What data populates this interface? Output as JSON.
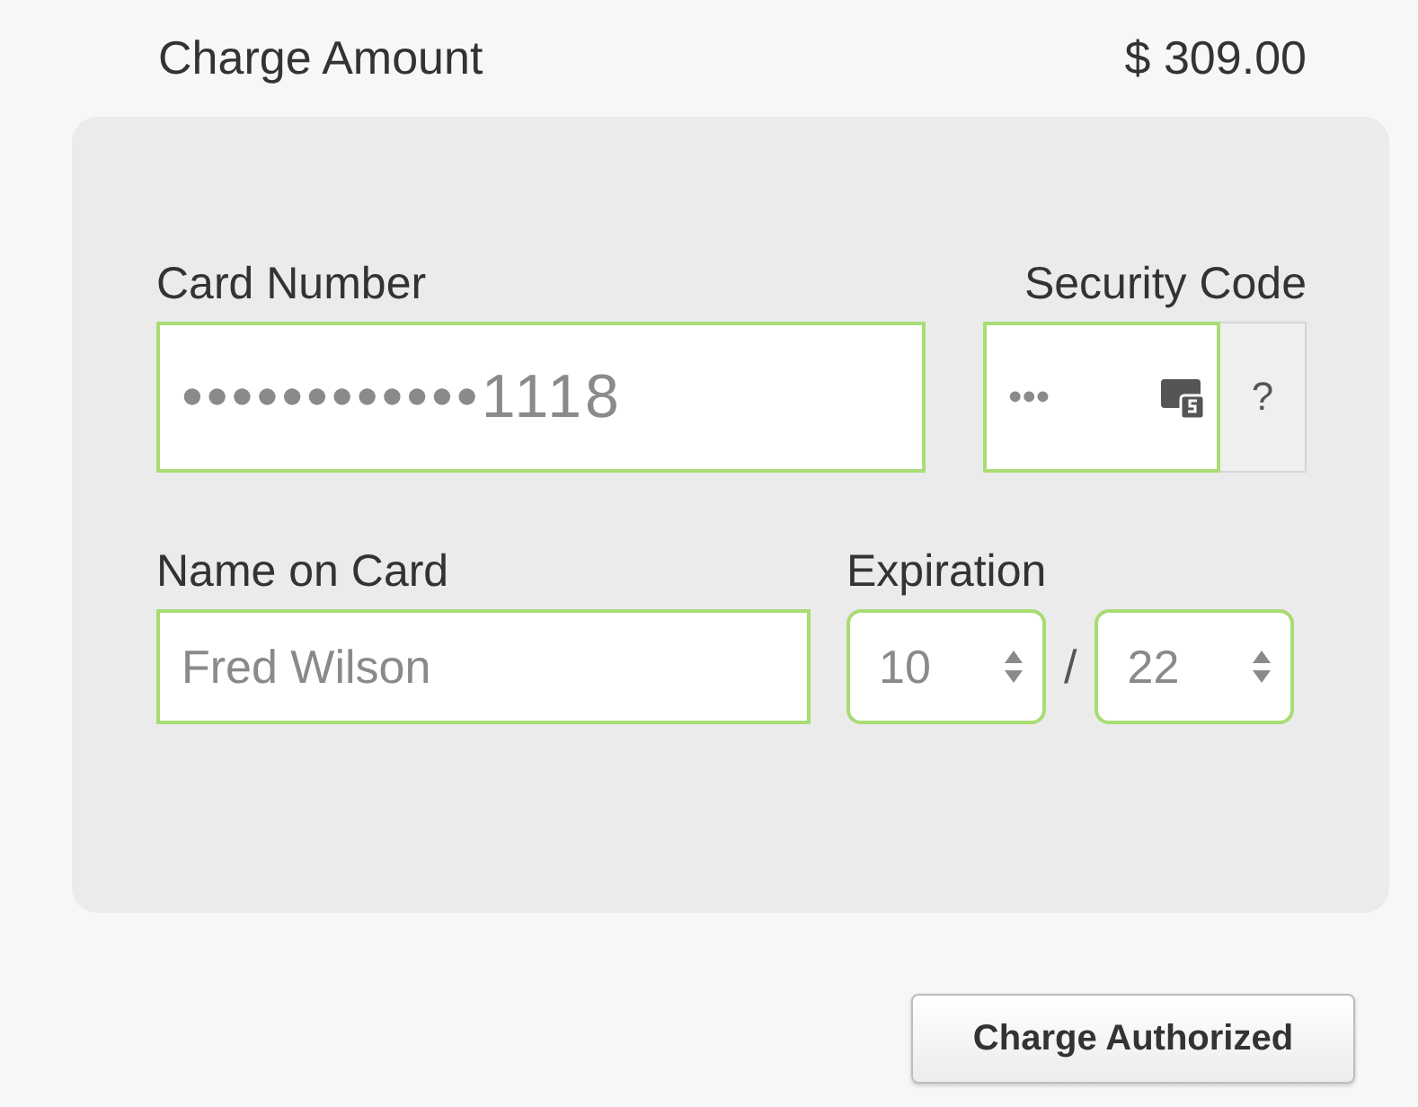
{
  "charge": {
    "label": "Charge Amount",
    "amount": "$ 309.00"
  },
  "card_number": {
    "label": "Card Number",
    "value": "••••••••••••1118"
  },
  "security_code": {
    "label": "Security Code",
    "value": "•••",
    "help": "?"
  },
  "name_on_card": {
    "label": "Name on Card",
    "value": "Fred Wilson"
  },
  "expiration": {
    "label": "Expiration",
    "month": "10",
    "separator": "/",
    "year": "22"
  },
  "submit": {
    "label": "Charge Authorized"
  }
}
